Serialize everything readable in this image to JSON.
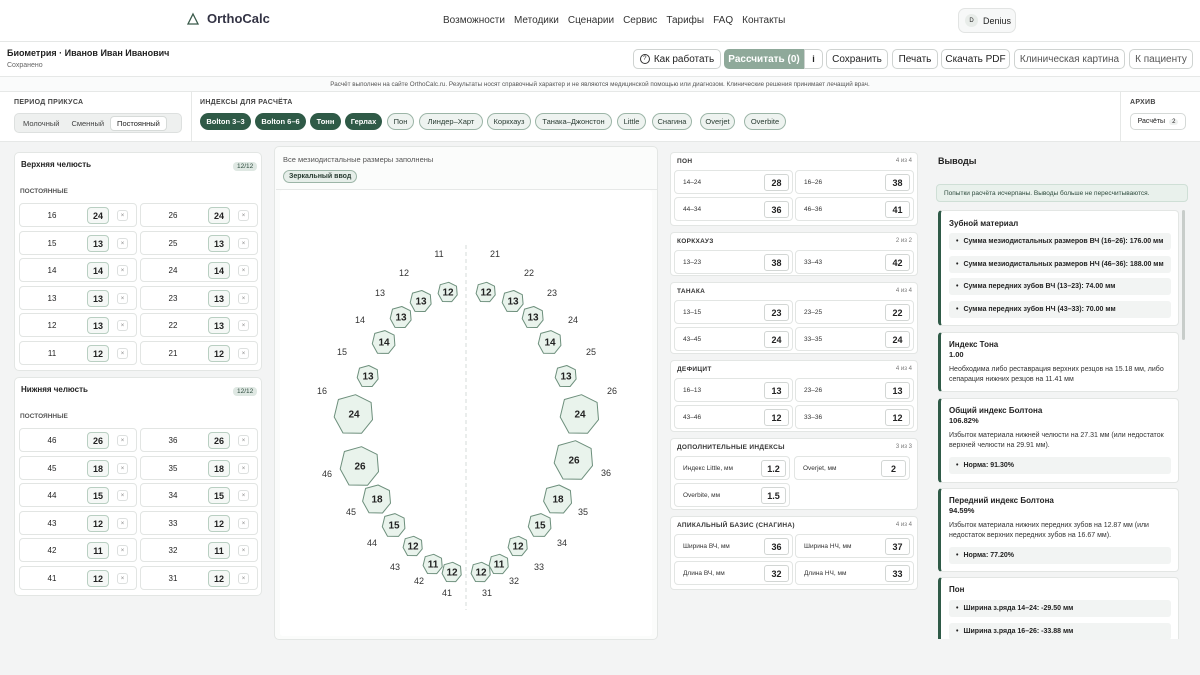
{
  "app": {
    "logo": "OrthoCalc"
  },
  "nav": [
    "Возможности",
    "Методики",
    "Сценарии",
    "Сервис",
    "Тарифы",
    "FAQ",
    "Контакты"
  ],
  "user": {
    "initial": "D",
    "name": "Denius"
  },
  "page": {
    "title": "Биометрия · Иванов Иван Иванович",
    "status": "Сохранено"
  },
  "toolbar": {
    "how": "Как работать",
    "calc": "Рассчитать",
    "calc_count": "(0)",
    "info": "i",
    "save": "Сохранить",
    "print": "Печать",
    "pdf": "Скачать PDF",
    "clinical": "Клиническая картина",
    "patient": "К пациенту"
  },
  "disclaimer": "Расчёт выполнен на сайте OrthoCalc.ru. Результаты носят справочный характер и не являются медицинской помощью или диагнозом. Клинические решения принимает лечащий врач.",
  "bite": {
    "label": "ПЕРИОД ПРИКУСА",
    "options": [
      "Молочный",
      "Сменный",
      "Постоянный"
    ],
    "selected": "Постоянный"
  },
  "indices": {
    "label": "ИНДЕКСЫ ДЛЯ РАСЧЁТА",
    "chips": [
      {
        "t": "Bolton 3–3",
        "on": true
      },
      {
        "t": "Bolton 6–6",
        "on": true
      },
      {
        "t": "Тонн",
        "on": true
      },
      {
        "t": "Герлах",
        "on": true
      },
      {
        "t": "Пон",
        "on": false
      },
      {
        "t": "Линдер–Харт",
        "on": false
      },
      {
        "t": "Коркхауз",
        "on": false
      },
      {
        "t": "Танака–Джонстон",
        "on": false
      },
      {
        "t": "Little",
        "on": false
      },
      {
        "t": "Снагина",
        "on": false
      },
      {
        "t": "Overjet",
        "on": false
      },
      {
        "t": "Overbite",
        "on": false
      }
    ]
  },
  "archive": {
    "label": "АРХИВ",
    "btn": "Расчёты",
    "count": "2"
  },
  "upper": {
    "title": "Верхняя челюсть",
    "count": "12/12",
    "sub": "ПОСТОЯННЫЕ",
    "rows": [
      [
        "16",
        "24",
        "26",
        "24"
      ],
      [
        "15",
        "13",
        "25",
        "13"
      ],
      [
        "14",
        "14",
        "24",
        "14"
      ],
      [
        "13",
        "13",
        "23",
        "13"
      ],
      [
        "12",
        "13",
        "22",
        "13"
      ],
      [
        "11",
        "12",
        "21",
        "12"
      ]
    ]
  },
  "lower": {
    "title": "Нижняя челюсть",
    "count": "12/12",
    "sub": "ПОСТОЯННЫЕ",
    "rows": [
      [
        "46",
        "26",
        "36",
        "26"
      ],
      [
        "45",
        "18",
        "35",
        "18"
      ],
      [
        "44",
        "15",
        "34",
        "15"
      ],
      [
        "43",
        "12",
        "33",
        "12"
      ],
      [
        "42",
        "11",
        "32",
        "11"
      ],
      [
        "41",
        "12",
        "31",
        "12"
      ]
    ]
  },
  "center": {
    "status": "Все мезиодистальные размеры заполнены",
    "mirror": "Зеркальный ввод"
  },
  "x_label": "×",
  "metrics": {
    "pon": {
      "h": "ПОН",
      "c": "4 из 4",
      "cells": [
        [
          "14–24",
          "28"
        ],
        [
          "16–26",
          "38"
        ],
        [
          "44–34",
          "36"
        ],
        [
          "46–36",
          "41"
        ]
      ]
    },
    "kork": {
      "h": "КОРКХАУЗ",
      "c": "2 из 2",
      "cells": [
        [
          "13–23",
          "38"
        ],
        [
          "33–43",
          "42"
        ]
      ]
    },
    "tanaka": {
      "h": "ТАНАКА",
      "c": "4 из 4",
      "cells": [
        [
          "13–15",
          "23"
        ],
        [
          "23–25",
          "22"
        ],
        [
          "43–45",
          "24"
        ],
        [
          "33–35",
          "24"
        ]
      ]
    },
    "deficit": {
      "h": "ДЕФИЦИТ",
      "c": "4 из 4",
      "cells": [
        [
          "16–13",
          "13"
        ],
        [
          "23–26",
          "13"
        ],
        [
          "43–46",
          "12"
        ],
        [
          "33–36",
          "12"
        ]
      ]
    },
    "extra": {
      "h": "ДОПОЛНИТЕЛЬНЫЕ ИНДЕКСЫ",
      "c": "3 из 3",
      "cells": [
        [
          "Индекс Little, мм",
          "1.2"
        ],
        [
          "Overjet, мм",
          "2"
        ],
        [
          "Overbite, мм",
          "1.5"
        ]
      ]
    },
    "apical": {
      "h": "АПИКАЛЬНЫЙ БАЗИС (СНАГИНА)",
      "c": "4 из 4",
      "cells": [
        [
          "Ширина ВЧ, мм",
          "36"
        ],
        [
          "Ширина НЧ, мм",
          "37"
        ],
        [
          "Длина ВЧ, мм",
          "32"
        ],
        [
          "Длина НЧ, мм",
          "33"
        ]
      ]
    }
  },
  "conclusions": {
    "title": "Выводы",
    "notice": "Попытки расчёта исчерпаны. Выводы больше не пересчитываются.",
    "material": {
      "t": "Зубной материал",
      "items": [
        "Сумма мезиодистальных размеров ВЧ (16–26): 176.00 мм",
        "Сумма мезиодистальных размеров НЧ (46–36): 188.00 мм",
        "Сумма передних зубов ВЧ (13–23): 74.00 мм",
        "Сумма передних зубов НЧ (43–33): 70.00 мм"
      ]
    },
    "tonn": {
      "t": "Индекс Тона",
      "v": "1.00",
      "p": "Необходима либо реставрация верхних резцов на 15.18 мм, либо сепарация нижних резцов на 11.41 мм"
    },
    "bolton": {
      "t": "Общий индекс Болтона",
      "v": "106.82%",
      "p": "Избыток материала нижней челюсти на 27.31 мм (или недостаток верхней челюсти на 29.91 мм).",
      "n": "Норма: 91.30%"
    },
    "bolton_front": {
      "t": "Передний индекс Болтона",
      "v": "94.59%",
      "p": "Избыток материала нижних передних зубов на 12.87 мм (или недостаток верхних передних зубов на 16.67 мм).",
      "n": "Норма: 77.20%"
    },
    "pon": {
      "t": "Пон",
      "items": [
        "Ширина з.ряда 14–24: -29.50 мм",
        "Ширина з.ряда 16–26: -33.88 мм"
      ]
    }
  },
  "arch": {
    "upper": [
      [
        "11",
        "12"
      ],
      [
        "12",
        "13"
      ],
      [
        "13",
        "13"
      ],
      [
        "14",
        "14"
      ],
      [
        "15",
        "13"
      ],
      [
        "16",
        "24"
      ],
      [
        "21",
        "12"
      ],
      [
        "22",
        "13"
      ],
      [
        "23",
        "13"
      ],
      [
        "24",
        "14"
      ],
      [
        "25",
        "13"
      ],
      [
        "26",
        "24"
      ]
    ],
    "lower": [
      [
        "46",
        "26"
      ],
      [
        "45",
        "18"
      ],
      [
        "44",
        "15"
      ],
      [
        "43",
        "12"
      ],
      [
        "42",
        "11"
      ],
      [
        "41",
        "12"
      ],
      [
        "36",
        "26"
      ],
      [
        "35",
        "18"
      ],
      [
        "34",
        "15"
      ],
      [
        "33",
        "12"
      ],
      [
        "32",
        "11"
      ],
      [
        "31",
        "12"
      ]
    ]
  }
}
